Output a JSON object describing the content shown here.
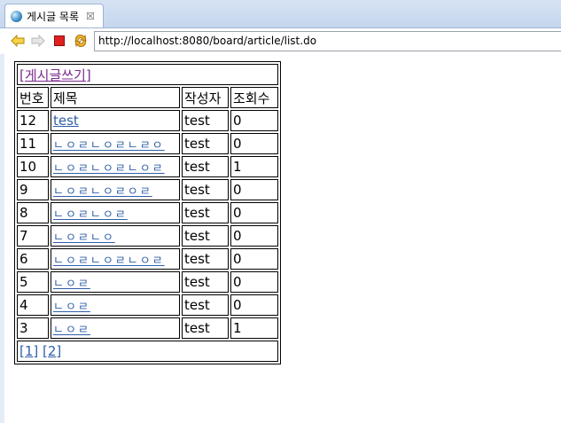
{
  "tab": {
    "title": "게시글 목록",
    "close": "☒"
  },
  "toolbar": {
    "url": "http://localhost:8080/board/article/list.do"
  },
  "board": {
    "write_link": "[게시글쓰기]",
    "headers": {
      "no": "번호",
      "title": "제목",
      "author": "작성자",
      "views": "조회수"
    },
    "rows": [
      {
        "no": "12",
        "title": "test",
        "author": "test",
        "views": "0"
      },
      {
        "no": "11",
        "title": "ㄴㅇㄹㄴㅇㄹㄴㄹㅇ",
        "author": "test",
        "views": "0"
      },
      {
        "no": "10",
        "title": "ㄴㅇㄹㄴㅇㄹㄴㅇㄹ",
        "author": "test",
        "views": "1"
      },
      {
        "no": "9",
        "title": "ㄴㅇㄹㄴㅇㄹㅇㄹ",
        "author": "test",
        "views": "0"
      },
      {
        "no": "8",
        "title": "ㄴㅇㄹㄴㅇㄹ",
        "author": "test",
        "views": "0"
      },
      {
        "no": "7",
        "title": "ㄴㅇㄹㄴㅇ",
        "author": "test",
        "views": "0"
      },
      {
        "no": "6",
        "title": "ㄴㅇㄹㄴㅇㄹㄴㅇㄹ",
        "author": "test",
        "views": "0"
      },
      {
        "no": "5",
        "title": "ㄴㅇㄹ",
        "author": "test",
        "views": "0"
      },
      {
        "no": "4",
        "title": "ㄴㅇㄹ",
        "author": "test",
        "views": "0"
      },
      {
        "no": "3",
        "title": "ㄴㅇㄹ",
        "author": "test",
        "views": "1"
      }
    ],
    "pages": [
      "[1]",
      "[2]"
    ]
  }
}
